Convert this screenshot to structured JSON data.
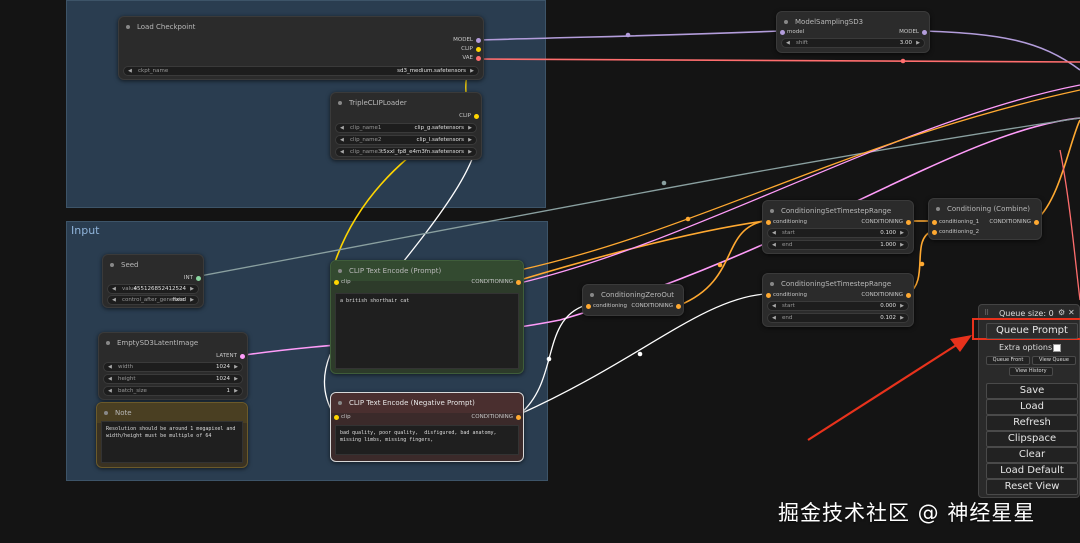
{
  "groups": {
    "input_title": "Input"
  },
  "nodes": {
    "load_checkpoint": {
      "title": "Load Checkpoint",
      "outputs": [
        "MODEL",
        "CLIP",
        "VAE"
      ],
      "ckpt_label": "ckpt_name",
      "ckpt_value": "sd3_medium.safetensors"
    },
    "model_sampling": {
      "title": "ModelSamplingSD3",
      "input": "model",
      "output": "MODEL",
      "shift_label": "shift",
      "shift_value": "3.00"
    },
    "triple_clip": {
      "title": "TripleCLIPLoader",
      "output": "CLIP",
      "w1_label": "clip_name1",
      "w1_value": "clip_g.safetensors",
      "w2_label": "clip_name2",
      "w2_value": "clip_l.safetensors",
      "w3_label": "clip_name3",
      "w3_value": "t5xxl_fp8_e4m3fn.safetensors"
    },
    "seed": {
      "title": "Seed",
      "output": "INT",
      "value_label": "value",
      "value_value": "455126852412524",
      "ctrl_label": "control_after_generate",
      "ctrl_value": "fixed"
    },
    "latent": {
      "title": "EmptySD3LatentImage",
      "output": "LATENT",
      "width_label": "width",
      "width_value": "1024",
      "height_label": "height",
      "height_value": "1024",
      "batch_label": "batch_size",
      "batch_value": "1"
    },
    "note": {
      "title": "Note",
      "text": "Resolution should be around 1 megapixel and\nwidth/height must be multiple of 64"
    },
    "clip_pos": {
      "title": "CLIP Text Encode (Prompt)",
      "input": "clip",
      "output": "CONDITIONING",
      "text": "a british shorthair cat"
    },
    "clip_neg": {
      "title": "CLIP Text Encode (Negative Prompt)",
      "input": "clip",
      "output": "CONDITIONING",
      "text": "bad quality, poor quality,  disfigured, bad anatomy,\nmissing limbs, missing fingers,"
    },
    "zero_out": {
      "title": "ConditioningZeroOut",
      "input": "conditioning",
      "output": "CONDITIONING"
    },
    "timestep1": {
      "title": "ConditioningSetTimestepRange",
      "input": "conditioning",
      "output": "CONDITIONING",
      "start_label": "start",
      "start_value": "0.100",
      "end_label": "end",
      "end_value": "1.000"
    },
    "timestep2": {
      "title": "ConditioningSetTimestepRange",
      "input": "conditioning",
      "output": "CONDITIONING",
      "start_label": "start",
      "start_value": "0.000",
      "end_label": "end",
      "end_value": "0.102"
    },
    "combine": {
      "title": "Conditioning (Combine)",
      "input1": "conditioning_1",
      "input2": "conditioning_2",
      "output": "CONDITIONING"
    }
  },
  "panel": {
    "queue_size": "Queue size: 0",
    "queue_prompt": "Queue Prompt",
    "extra_options": "Extra options",
    "queue_front": "Queue Front",
    "view_queue": "View Queue",
    "view_history": "View History",
    "buttons": [
      "Save",
      "Load",
      "Refresh",
      "Clipspace",
      "Clear",
      "Load Default",
      "Reset View"
    ]
  },
  "watermark": "掘金技术社区 @ 神经星星",
  "icons": {
    "gear": "gear-icon",
    "close": "close-icon",
    "arrow": "annotation-arrow"
  },
  "colors": {
    "model": "#b39ddb",
    "clip": "#ffd500",
    "vae": "#ff6e6e",
    "conditioning": "#ffa931",
    "latent": "#ff9cf9",
    "int": "#8ad6a0",
    "annotation": "#e8321c"
  }
}
